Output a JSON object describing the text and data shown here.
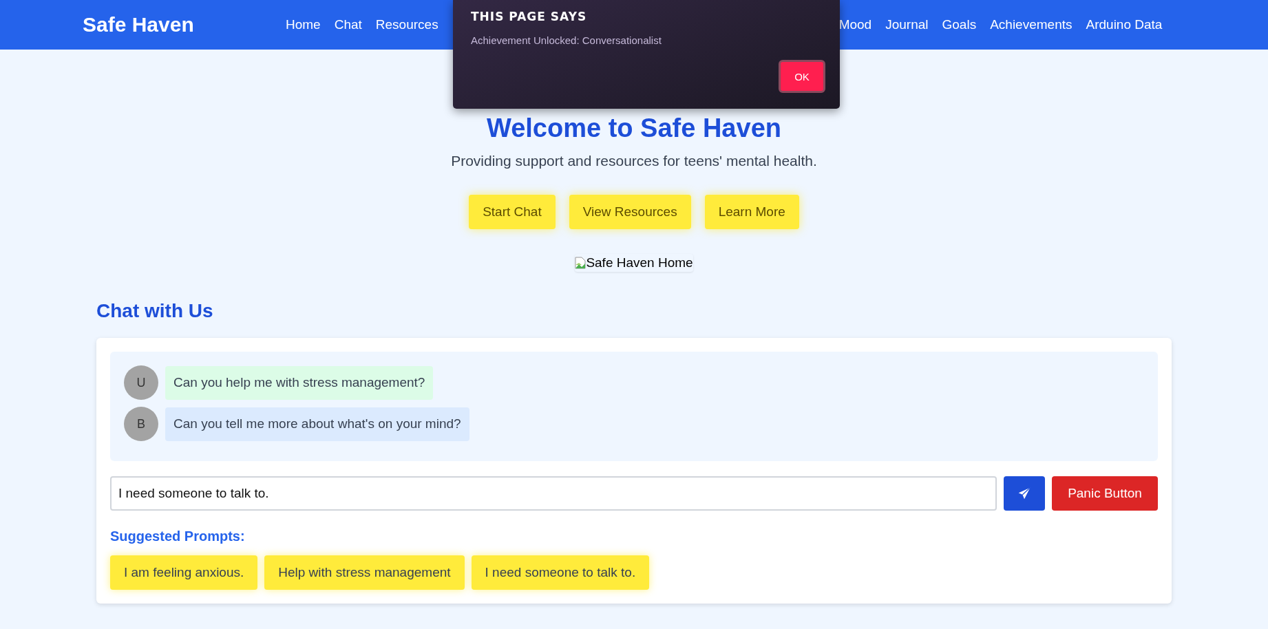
{
  "navbar": {
    "logo": "Safe Haven",
    "links_left": [
      "Home",
      "Chat",
      "Resources"
    ],
    "links_right": [
      "Mood",
      "Journal",
      "Goals",
      "Achievements",
      "Arduino Data"
    ]
  },
  "hero": {
    "title": "Welcome to Safe Haven",
    "subtitle": "Providing support and resources for teens' mental health.",
    "buttons": [
      "Start Chat",
      "View Resources",
      "Learn More"
    ],
    "image_alt": "Safe Haven Home"
  },
  "chat": {
    "heading": "Chat with Us",
    "messages": [
      {
        "kind": "user",
        "avatar": "U",
        "text": "Can you help me with stress management?"
      },
      {
        "kind": "bot",
        "avatar": "B",
        "text": "Can you tell me more about what's on your mind?"
      }
    ],
    "input": {
      "value": "I need someone to talk to."
    },
    "panic_button": "Panic Button",
    "prompts_heading": "Suggested Prompts:",
    "prompts": [
      "I am feeling anxious.",
      "Help with stress management",
      "I need someone to talk to."
    ]
  },
  "dialog": {
    "title": "THIS PAGE SAYS",
    "message": "Achievement Unlocked: Conversationalist",
    "button": "OK"
  }
}
